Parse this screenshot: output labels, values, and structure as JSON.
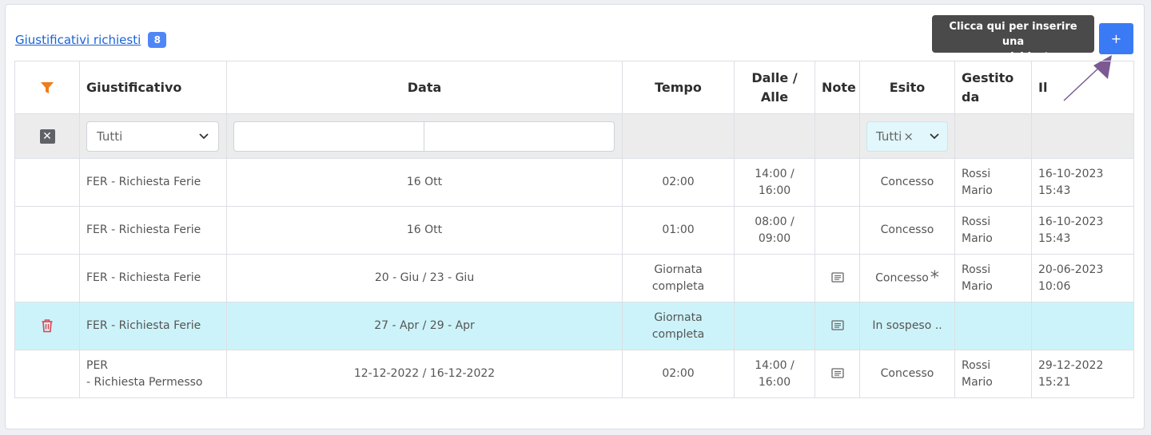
{
  "header": {
    "title": "Giustificativi richiesti",
    "count": "8"
  },
  "tooltip": {
    "line1": "Clicca qui per inserire una",
    "line2": "nuova richiesta."
  },
  "add_button": {
    "label": "+"
  },
  "columns": {
    "giustificativo": "Giustificativo",
    "data": "Data",
    "tempo": "Tempo",
    "dalle_line1": "Dalle /",
    "dalle_line2": "Alle",
    "note": "Note",
    "esito": "Esito",
    "gestito_line1": "Gestito",
    "gestito_line2": "da",
    "il": "Il"
  },
  "filters": {
    "giustificativo": "Tutti",
    "date_from": "",
    "date_to": "",
    "esito": "Tutti",
    "esito_clear": "×"
  },
  "rows": [
    {
      "giustificativo_l1": "FER - Richiesta Ferie",
      "giustificativo_l2": "",
      "data": "16 Ott",
      "tempo_l1": "02:00",
      "tempo_l2": "",
      "dalle_l1": "14:00 /",
      "dalle_l2": "16:00",
      "esito": "Concesso",
      "gestito_l1": "Rossi",
      "gestito_l2": "Mario",
      "il_l1": "16-10-2023",
      "il_l2": "15:43"
    },
    {
      "giustificativo_l1": "FER - Richiesta Ferie",
      "giustificativo_l2": "",
      "data": "16 Ott",
      "tempo_l1": "01:00",
      "tempo_l2": "",
      "dalle_l1": "08:00 /",
      "dalle_l2": "09:00",
      "esito": "Concesso",
      "gestito_l1": "Rossi",
      "gestito_l2": "Mario",
      "il_l1": "16-10-2023",
      "il_l2": "15:43"
    },
    {
      "giustificativo_l1": "FER - Richiesta Ferie",
      "giustificativo_l2": "",
      "data": "20 - Giu / 23 - Giu",
      "tempo_l1": "Giornata",
      "tempo_l2": "completa",
      "dalle_l1": "",
      "dalle_l2": "",
      "esito": "Concesso",
      "esito_mark": "*",
      "gestito_l1": "Rossi",
      "gestito_l2": "Mario",
      "il_l1": "20-06-2023",
      "il_l2": "10:06"
    },
    {
      "giustificativo_l1": "FER - Richiesta Ferie",
      "giustificativo_l2": "",
      "data": "27 - Apr / 29 - Apr",
      "tempo_l1": "Giornata",
      "tempo_l2": "completa",
      "dalle_l1": "",
      "dalle_l2": "",
      "esito": "In sospeso ..",
      "gestito_l1": "",
      "gestito_l2": "",
      "il_l1": "",
      "il_l2": ""
    },
    {
      "giustificativo_l1": "PER",
      "giustificativo_l2": "- Richiesta Permesso",
      "data": "12-12-2022 / 16-12-2022",
      "tempo_l1": "02:00",
      "tempo_l2": "",
      "dalle_l1": "14:00 /",
      "dalle_l2": "16:00",
      "esito": "Concesso",
      "gestito_l1": "Rossi",
      "gestito_l2": "Mario",
      "il_l1": "29-12-2022",
      "il_l2": "15:21"
    }
  ],
  "colors": {
    "accent": "#3b7af5",
    "filter_icon": "#f07c1a",
    "delete_icon": "#e0424f",
    "highlight_row": "#cdf3fa",
    "arrow": "#7b5a93"
  }
}
